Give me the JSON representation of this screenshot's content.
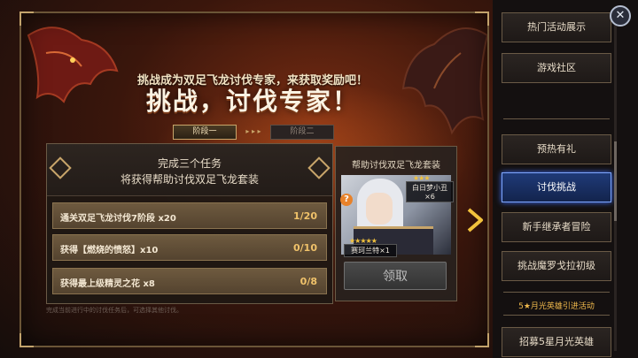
{
  "banner": {
    "subtitle": "挑战成为双足飞龙讨伐专家，来获取奖励吧！",
    "title": "挑战，讨伐专家！"
  },
  "stages": [
    {
      "label": "阶段一",
      "active": true
    },
    {
      "label": "阶段二",
      "active": false
    }
  ],
  "stage_arrows": "▸ ▸ ▸",
  "task_panel": {
    "line1": "完成三个任务",
    "line2": "将获得帮助讨伐双足飞龙套装",
    "tasks": [
      {
        "label": "通关双足飞龙讨伐7阶段 x20",
        "count": "1/20"
      },
      {
        "label": "获得【燃烧的愤怒】x10",
        "count": "0/10"
      },
      {
        "label": "获得最上级精灵之花 x8",
        "count": "0/8"
      }
    ],
    "footnote": "完成当前进行中的讨伐任务后，可选择其他讨伐。"
  },
  "reward": {
    "title": "帮助讨伐双足飞龙套装",
    "item_top": {
      "name": "白日梦小丑",
      "qty": "×6",
      "stars": "★★★"
    },
    "item_hero": {
      "name": "赛珂兰特×1",
      "stars": "★★★★★"
    },
    "claim_label": "领取",
    "badge": "?"
  },
  "sidebar": {
    "items": [
      {
        "label": "热门活动展示"
      },
      {
        "label": "游戏社区"
      },
      {
        "label": "预热有礼"
      },
      {
        "label": "讨伐挑战",
        "active": true
      },
      {
        "label": "新手继承者冒险"
      },
      {
        "label": "挑战魔罗戈拉初级"
      },
      {
        "label": "招募5星月光英雄"
      }
    ],
    "highlight_text": "5★月光英雄引进活动"
  },
  "icons": {
    "close": "close-icon",
    "next": "chevron-right-icon",
    "help": "question-icon"
  },
  "colors": {
    "accent_gold": "#c8a56a",
    "active_blue": "#1f3a78",
    "progress_text": "#f0c26a"
  }
}
